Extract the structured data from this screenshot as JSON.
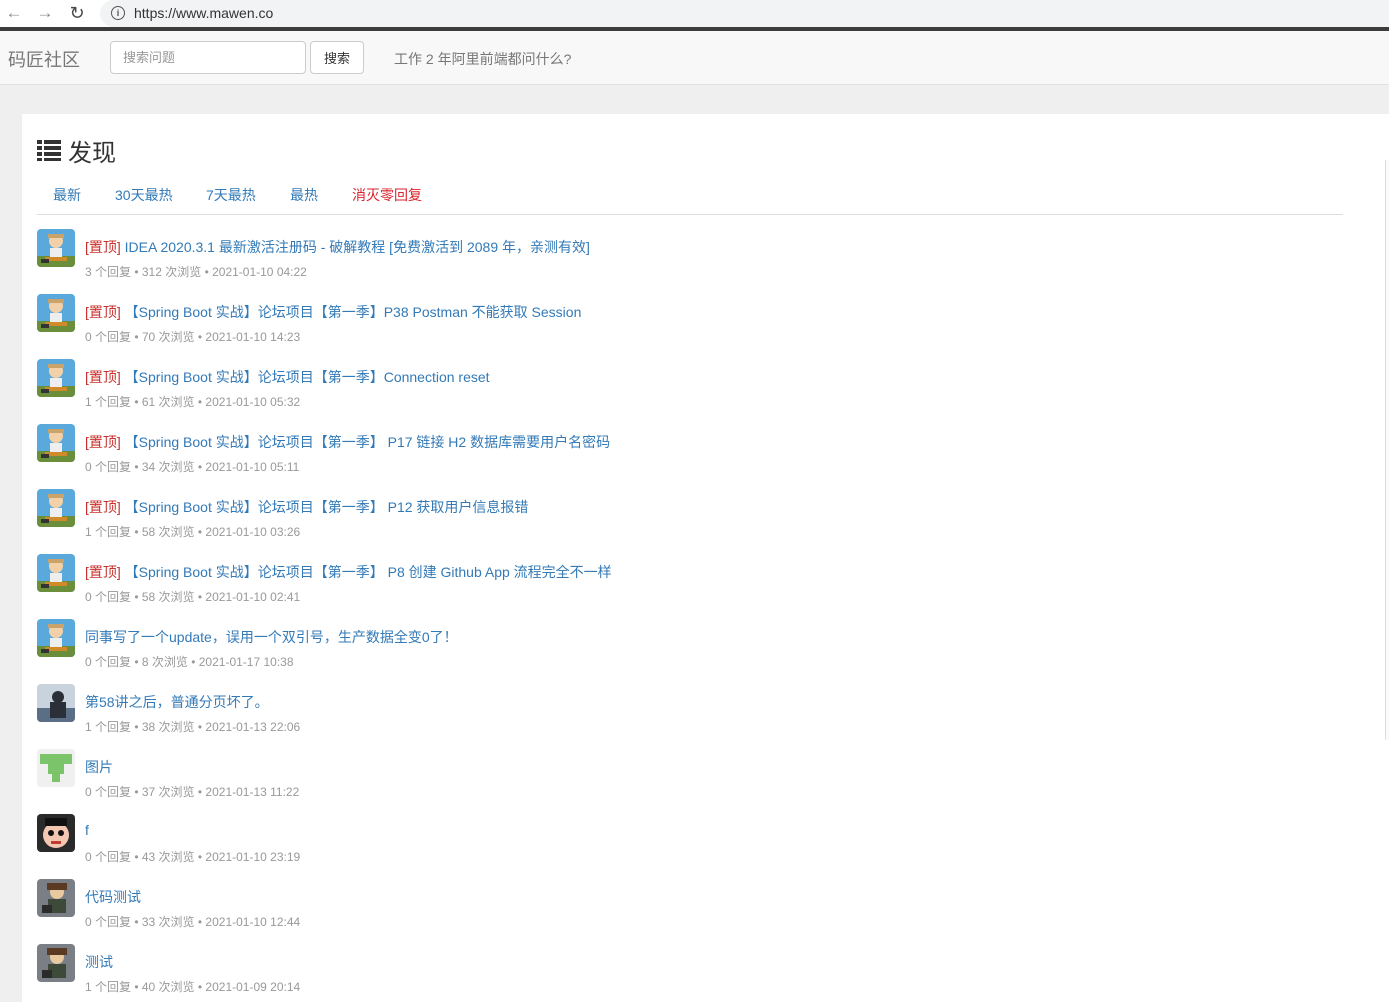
{
  "browser": {
    "url": "https://www.mawen.co",
    "back_glyph": "←",
    "forward_glyph": "→",
    "reload_glyph": "↻",
    "info_glyph": "i"
  },
  "navbar": {
    "brand": "码匠社区",
    "search_placeholder": "搜索问题",
    "search_button": "搜索",
    "link": "工作 2 年阿里前端都问什么?"
  },
  "main": {
    "title": "发现",
    "title_icon": "list-icon",
    "tabs": [
      {
        "label": "最新",
        "active": false
      },
      {
        "label": "30天最热",
        "active": false
      },
      {
        "label": "7天最热",
        "active": false
      },
      {
        "label": "最热",
        "active": false
      },
      {
        "label": "消灭零回复",
        "active": false
      }
    ],
    "topics": [
      {
        "pin": "[置顶]",
        "title": " IDEA 2020.3.1 最新激活注册码 - 破解教程 [免费激活到 2089 年，亲测有效]",
        "meta": "3 个回复 • 312 次浏览 • 2021-01-10 04:22",
        "avatar": "cartoon-avatar"
      },
      {
        "pin": "[置顶]",
        "title": " 【Spring Boot 实战】论坛项目【第一季】P38 Postman 不能获取 Session",
        "meta": "0 个回复 • 70 次浏览 • 2021-01-10 14:23",
        "avatar": "cartoon-avatar"
      },
      {
        "pin": "[置顶]",
        "title": " 【Spring Boot 实战】论坛项目【第一季】Connection reset",
        "meta": "1 个回复 • 61 次浏览 • 2021-01-10 05:32",
        "avatar": "cartoon-avatar"
      },
      {
        "pin": "[置顶]",
        "title": " 【Spring Boot 实战】论坛项目【第一季】 P17 链接 H2 数据库需要用户名密码",
        "meta": "0 个回复 • 34 次浏览 • 2021-01-10 05:11",
        "avatar": "cartoon-avatar"
      },
      {
        "pin": "[置顶]",
        "title": " 【Spring Boot 实战】论坛项目【第一季】 P12 获取用户信息报错",
        "meta": "1 个回复 • 58 次浏览 • 2021-01-10 03:26",
        "avatar": "cartoon-avatar"
      },
      {
        "pin": "[置顶]",
        "title": " 【Spring Boot 实战】论坛项目【第一季】 P8 创建 Github App 流程完全不一样",
        "meta": "0 个回复 • 58 次浏览 • 2021-01-10 02:41",
        "avatar": "cartoon-avatar"
      },
      {
        "pin": "",
        "title": "同事写了一个update，误用一个双引号，生产数据全变0了！",
        "meta": "0 个回复 • 8 次浏览 • 2021-01-17 10:38",
        "avatar": "cartoon-avatar"
      },
      {
        "pin": "",
        "title": "第58讲之后，普通分页坏了。",
        "meta": "1 个回复 • 38 次浏览 • 2021-01-13 22:06",
        "avatar": "photo-avatar"
      },
      {
        "pin": "",
        "title": "图片",
        "meta": "0 个回复 • 37 次浏览 • 2021-01-13 11:22",
        "avatar": "identicon-avatar"
      },
      {
        "pin": "",
        "title": "f",
        "meta": "0 个回复 • 43 次浏览 • 2021-01-10 23:19",
        "avatar": "face-avatar"
      },
      {
        "pin": "",
        "title": "代码测试",
        "meta": "0 个回复 • 33 次浏览 • 2021-01-10 12:44",
        "avatar": "anime-avatar"
      },
      {
        "pin": "",
        "title": "测试",
        "meta": "1 个回复 • 40 次浏览 • 2021-01-09 20:14",
        "avatar": "anime-avatar"
      }
    ]
  },
  "colors": {
    "link": "#337ab7",
    "pin": "#c9302c",
    "danger_tab": "#d9232d",
    "meta": "#999999"
  }
}
